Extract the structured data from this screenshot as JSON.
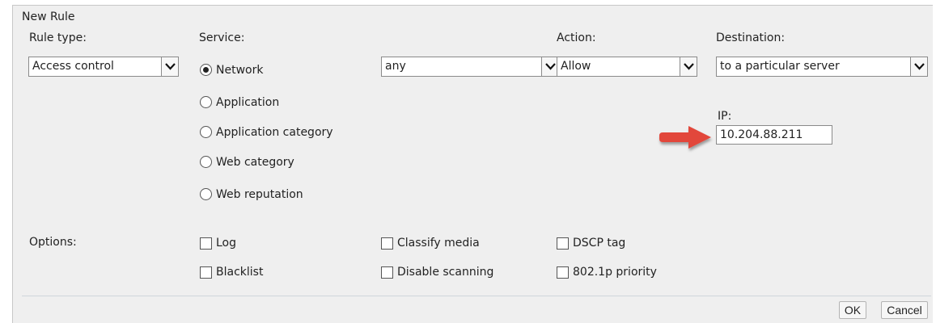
{
  "dialog": {
    "title": "New Rule"
  },
  "rule_type": {
    "label": "Rule type:",
    "value": "Access control"
  },
  "service": {
    "label": "Service:",
    "options": [
      {
        "label": "Network",
        "selected": true
      },
      {
        "label": "Application",
        "selected": false
      },
      {
        "label": "Application category",
        "selected": false
      },
      {
        "label": "Web category",
        "selected": false
      },
      {
        "label": "Web reputation",
        "selected": false
      }
    ],
    "network_value": "any"
  },
  "action": {
    "label": "Action:",
    "value": "Allow"
  },
  "destination": {
    "label": "Destination:",
    "value": "to a particular server",
    "ip_label": "IP:",
    "ip_value": "10.204.88.211"
  },
  "options": {
    "label": "Options:",
    "items": [
      {
        "label": "Log",
        "checked": false
      },
      {
        "label": "Classify media",
        "checked": false
      },
      {
        "label": "DSCP tag",
        "checked": false
      },
      {
        "label": "Blacklist",
        "checked": false
      },
      {
        "label": "Disable scanning",
        "checked": false
      },
      {
        "label": "802.1p priority",
        "checked": false
      }
    ]
  },
  "buttons": {
    "ok": "OK",
    "cancel": "Cancel"
  },
  "colors": {
    "panel_bg": "#efefef",
    "annotation_arrow": "#e2473b"
  },
  "icons": {
    "select_arrow": "chevron-down-icon",
    "annotation": "red-arrow-icon"
  }
}
